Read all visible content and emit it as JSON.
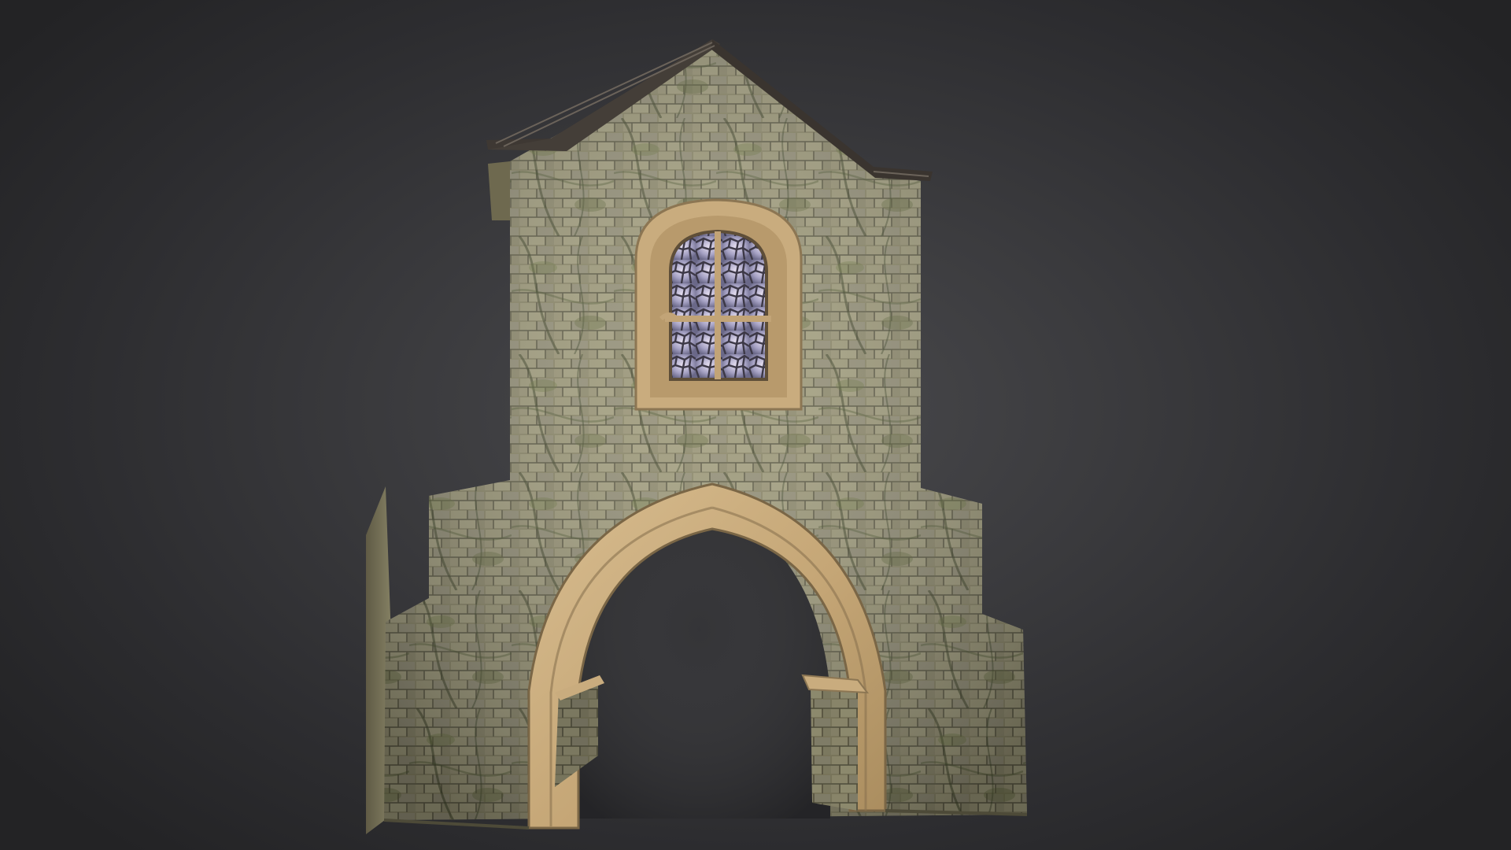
{
  "viewer": {
    "background_color": "#2b2b2d",
    "model": {
      "type": "3d-model",
      "subject": "stone-gatehouse",
      "colors": {
        "stone": "#8e8a6a",
        "moss": "#5f6840",
        "sandstone_trim": "#c9ac7e",
        "roof": "#3e3833",
        "glass": "#a8a6c8"
      }
    }
  }
}
